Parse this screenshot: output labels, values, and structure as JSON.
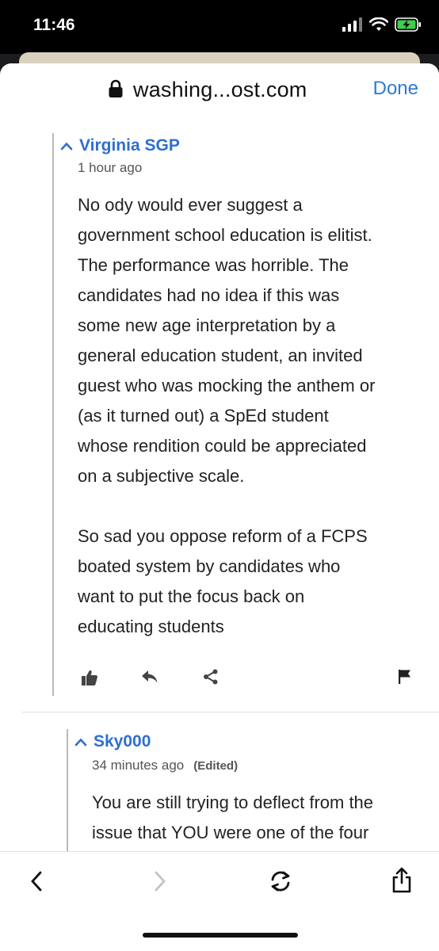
{
  "status_bar": {
    "time": "11:46"
  },
  "browser": {
    "url": "washing...ost.com",
    "done_label": "Done"
  },
  "comments": [
    {
      "author": "Virginia SGP",
      "time": "1 hour ago",
      "paragraphs": [
        [
          "No ody would ever suggest a",
          "government school education is elitist.",
          "The performance was horrible. The",
          "candidates had no idea if this was",
          "some new age interpretation by a",
          "general education student, an invited",
          "guest who was mocking the anthem or",
          "(as it turned out) a SpEd student",
          "whose rendition could be appreciated",
          "on a subjective scale."
        ],
        [
          "So sad you oppose reform of a FCPS",
          "boated system by candidates who",
          "want to put the focus back on",
          "educating students"
        ]
      ]
    },
    {
      "author": "Sky000",
      "time": "34 minutes ago",
      "edited": "(Edited)",
      "lines": [
        "You are still trying to deflect from the",
        "issue that YOU were one of the four"
      ]
    }
  ],
  "colors": {
    "accent": "#2e6fd0",
    "link": "#2f7bd4",
    "text": "#222222"
  }
}
